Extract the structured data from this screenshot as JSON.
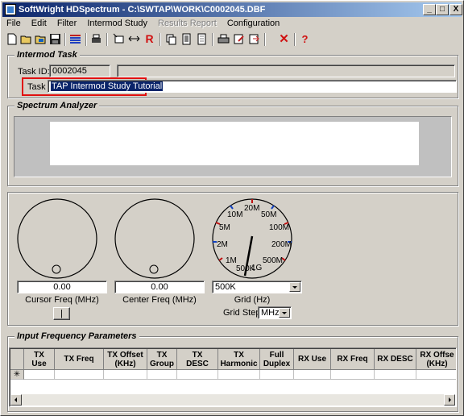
{
  "window": {
    "title": "SoftWright HDSpectrum - C:\\SWTAP\\WORK\\C0002045.DBF",
    "minimize": "_",
    "maximize": "□",
    "close": "X"
  },
  "menu": [
    {
      "label": "File",
      "enabled": true
    },
    {
      "label": "Edit",
      "enabled": true
    },
    {
      "label": "Filter",
      "enabled": true
    },
    {
      "label": "Intermod Study",
      "enabled": true
    },
    {
      "label": "Results Report",
      "enabled": false
    },
    {
      "label": "Configuration",
      "enabled": true
    }
  ],
  "toolbar": {
    "icons": [
      "new-icon",
      "open-icon",
      "open-db-icon",
      "save-icon",
      "list-icon",
      "print-preview-icon",
      "select-icon",
      "swap-icon",
      "r-icon",
      "copy-icon",
      "doc-icon",
      "doc2-icon",
      "print-icon",
      "edit-icon",
      "exit-icon",
      "delete-icon",
      "help-icon"
    ],
    "r_label": "R",
    "delete_label": "✕",
    "help_label": "?"
  },
  "intermod_task": {
    "title": "Intermod Task",
    "task_id_label": "Task ID:",
    "task_id_value": "0002045",
    "task_label": "Task",
    "task_value": "TAP Intermod Study Tutorial"
  },
  "spectrum_analyzer": {
    "title": "Spectrum Analyzer"
  },
  "controls": {
    "cursor_freq_value": "0.00",
    "cursor_freq_label": "Cursor Freq (MHz)",
    "center_freq_value": "0.00",
    "center_freq_label": "Center Freq (MHz)",
    "toggle_button": "|",
    "grid_value": "500K",
    "grid_label": "Grid (Hz)",
    "grid_step_label": "Grid Step",
    "grid_step_value": "MHz",
    "grid_dial_labels": [
      "20M",
      "50M",
      "100M",
      "200M",
      "500M",
      "1G",
      "500K",
      "1M",
      "2M",
      "5M",
      "10M"
    ]
  },
  "input_freq": {
    "title": "Input Frequency Parameters",
    "columns": [
      "TX\nUse",
      "TX Freq",
      "TX Offset\n(KHz)",
      "TX\nGroup",
      "TX\nDESC",
      "TX\nHarmonic",
      "Full\nDuplex",
      "RX Use",
      "RX Freq",
      "RX DESC",
      "RX Offse\n(KHz)"
    ],
    "new_row_marker": "✳"
  }
}
